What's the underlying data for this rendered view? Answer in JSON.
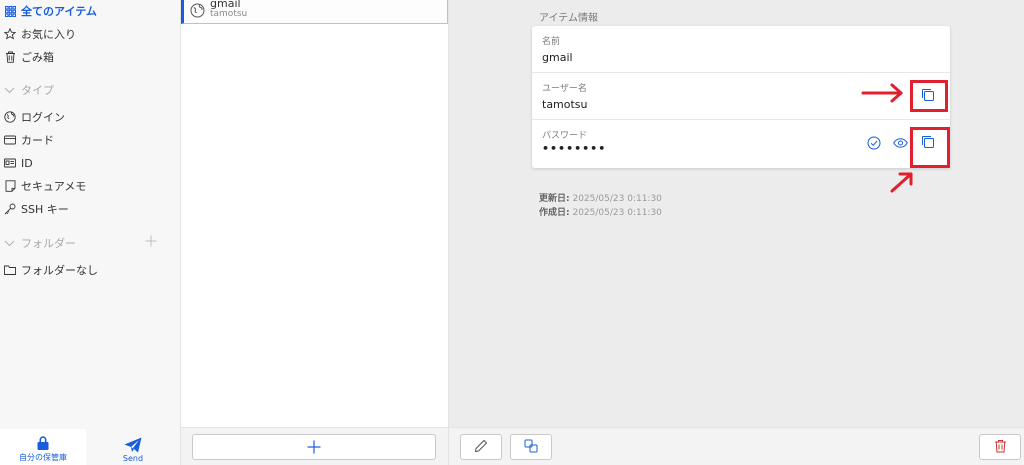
{
  "sidebar": {
    "all_items": "全てのアイテム",
    "favorites": "お気に入り",
    "trash": "ごみ箱",
    "types_heading": "タイプ",
    "types": [
      "ログイン",
      "カード",
      "ID",
      "セキュアメモ",
      "SSH キー"
    ],
    "folders_heading": "フォルダー",
    "no_folder": "フォルダーなし",
    "tab_vault": "自分の保管庫",
    "tab_send": "Send"
  },
  "list": {
    "items": [
      {
        "name": "gmail",
        "username": "tamotsu"
      }
    ]
  },
  "detail": {
    "section_title": "アイテム情報",
    "name_label": "名前",
    "name_value": "gmail",
    "username_label": "ユーザー名",
    "username_value": "tamotsu",
    "password_label": "パスワード",
    "password_value": "••••••••",
    "updated_label": "更新日:",
    "updated_value": "2025/05/23 0:11:30",
    "created_label": "作成日:",
    "created_value": "2025/05/23 0:11:30"
  },
  "colors": {
    "accent": "#175ddc",
    "annotation_red": "#e01f2f",
    "detail_bg": "#ececec",
    "trash_red": "#c8342f"
  }
}
